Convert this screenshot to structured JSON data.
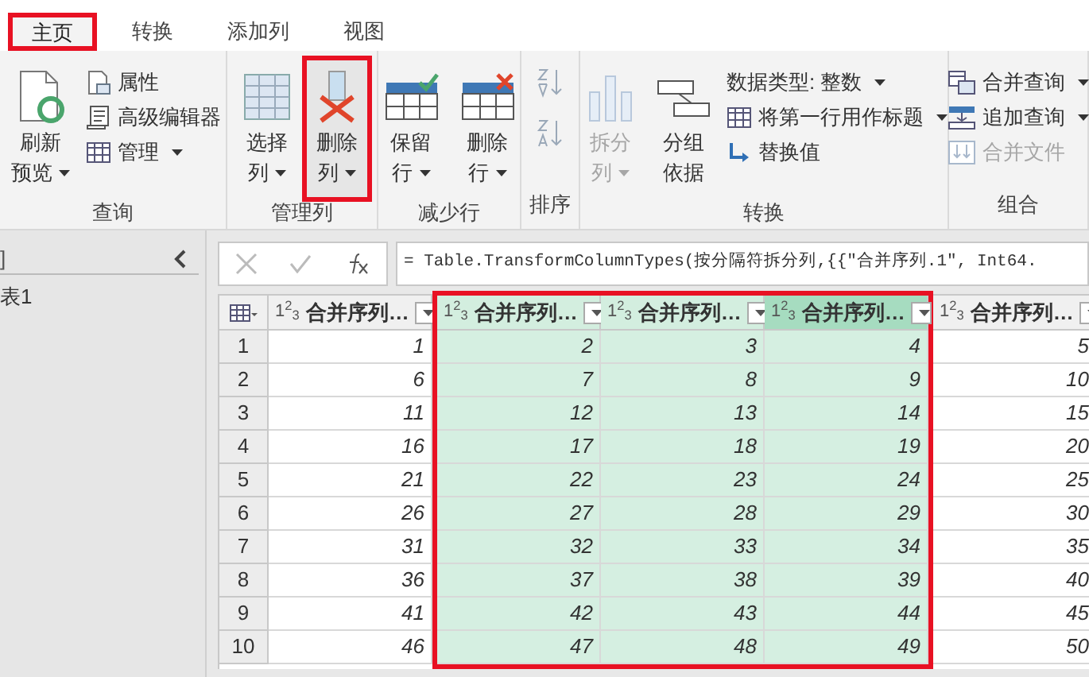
{
  "tabs": [
    {
      "label": "主页",
      "selected": true,
      "highlighted": true
    },
    {
      "label": "转换",
      "selected": false,
      "highlighted": false
    },
    {
      "label": "添加列",
      "selected": false,
      "highlighted": false
    },
    {
      "label": "视图",
      "selected": false,
      "highlighted": false
    }
  ],
  "ribbon": {
    "groups": [
      {
        "label": "查询",
        "items": [
          {
            "kind": "large",
            "lines": [
              "刷新",
              "预览"
            ],
            "dropdown": true,
            "disabled": false,
            "highlighted": false
          },
          {
            "kind": "stack",
            "items": [
              {
                "label": "属性",
                "dropdown": false,
                "disabled": false
              },
              {
                "label": "高级编辑器",
                "dropdown": false,
                "disabled": false
              },
              {
                "label": "管理",
                "dropdown": true,
                "disabled": false
              }
            ]
          }
        ]
      },
      {
        "label": "管理列",
        "items": [
          {
            "kind": "large",
            "lines": [
              "选择",
              "列"
            ],
            "dropdown": true,
            "disabled": false,
            "highlighted": false
          },
          {
            "kind": "large",
            "lines": [
              "删除",
              "列"
            ],
            "dropdown": true,
            "disabled": false,
            "highlighted": true
          }
        ]
      },
      {
        "label": "减少行",
        "items": [
          {
            "kind": "large",
            "lines": [
              "保留",
              "行"
            ],
            "dropdown": true,
            "disabled": false,
            "highlighted": false
          },
          {
            "kind": "large",
            "lines": [
              "删除",
              "行"
            ],
            "dropdown": true,
            "disabled": false,
            "highlighted": false
          }
        ]
      },
      {
        "label": "排序",
        "items": [
          {
            "kind": "sort"
          }
        ]
      },
      {
        "label": "转换",
        "items": [
          {
            "kind": "large",
            "lines": [
              "拆分",
              "列"
            ],
            "dropdown": true,
            "disabled": true,
            "highlighted": false
          },
          {
            "kind": "large",
            "lines": [
              "分组",
              "依据"
            ],
            "dropdown": false,
            "disabled": false,
            "highlighted": false
          },
          {
            "kind": "stack",
            "items": [
              {
                "label": "数据类型: 整数",
                "dropdown": true,
                "disabled": false
              },
              {
                "label": "将第一行用作标题",
                "dropdown": true,
                "disabled": false
              },
              {
                "label": "替换值",
                "dropdown": false,
                "disabled": false
              }
            ]
          }
        ]
      },
      {
        "label": "组合",
        "items": [
          {
            "kind": "stack",
            "items": [
              {
                "label": "合并查询",
                "dropdown": true,
                "disabled": false
              },
              {
                "label": "追加查询",
                "dropdown": true,
                "disabled": false
              },
              {
                "label": "合并文件",
                "dropdown": false,
                "disabled": true
              }
            ]
          }
        ]
      }
    ]
  },
  "queries_pane": {
    "header": "]",
    "items": [
      "表1"
    ]
  },
  "formula": "= Table.TransformColumnTypes(按分隔符拆分列,{{\"合并序列.1\", Int64.",
  "table": {
    "columns": [
      {
        "type": "1$^{2}$$_{3}$",
        "label": "合并序列…",
        "selected": false,
        "active": false,
        "highlighted": false
      },
      {
        "type": "1$^{2}$$_{3}$",
        "label": "合并序列…",
        "selected": true,
        "active": false,
        "highlighted": true
      },
      {
        "type": "1$^{2}$$_{3}$",
        "label": "合并序列…",
        "selected": true,
        "active": false,
        "highlighted": true
      },
      {
        "type": "1$^{2}$$_{3}$",
        "label": "合并序列…",
        "selected": true,
        "active": true,
        "highlighted": true
      },
      {
        "type": "1$^{2}$$_{3}$",
        "label": "合并序列…",
        "selected": false,
        "active": false,
        "highlighted": false
      }
    ],
    "rows": [
      {
        "index": "1",
        "cells": [
          "1",
          "2",
          "3",
          "4",
          "5"
        ]
      },
      {
        "index": "2",
        "cells": [
          "6",
          "7",
          "8",
          "9",
          "10"
        ]
      },
      {
        "index": "3",
        "cells": [
          "11",
          "12",
          "13",
          "14",
          "15"
        ]
      },
      {
        "index": "4",
        "cells": [
          "16",
          "17",
          "18",
          "19",
          "20"
        ]
      },
      {
        "index": "5",
        "cells": [
          "21",
          "22",
          "23",
          "24",
          "25"
        ]
      },
      {
        "index": "6",
        "cells": [
          "26",
          "27",
          "28",
          "29",
          "30"
        ]
      },
      {
        "index": "7",
        "cells": [
          "31",
          "32",
          "33",
          "34",
          "35"
        ]
      },
      {
        "index": "8",
        "cells": [
          "36",
          "37",
          "38",
          "39",
          "40"
        ]
      },
      {
        "index": "9",
        "cells": [
          "41",
          "42",
          "43",
          "44",
          "45"
        ]
      },
      {
        "index": "10",
        "cells": [
          "46",
          "47",
          "48",
          "49",
          "50"
        ]
      }
    ]
  }
}
